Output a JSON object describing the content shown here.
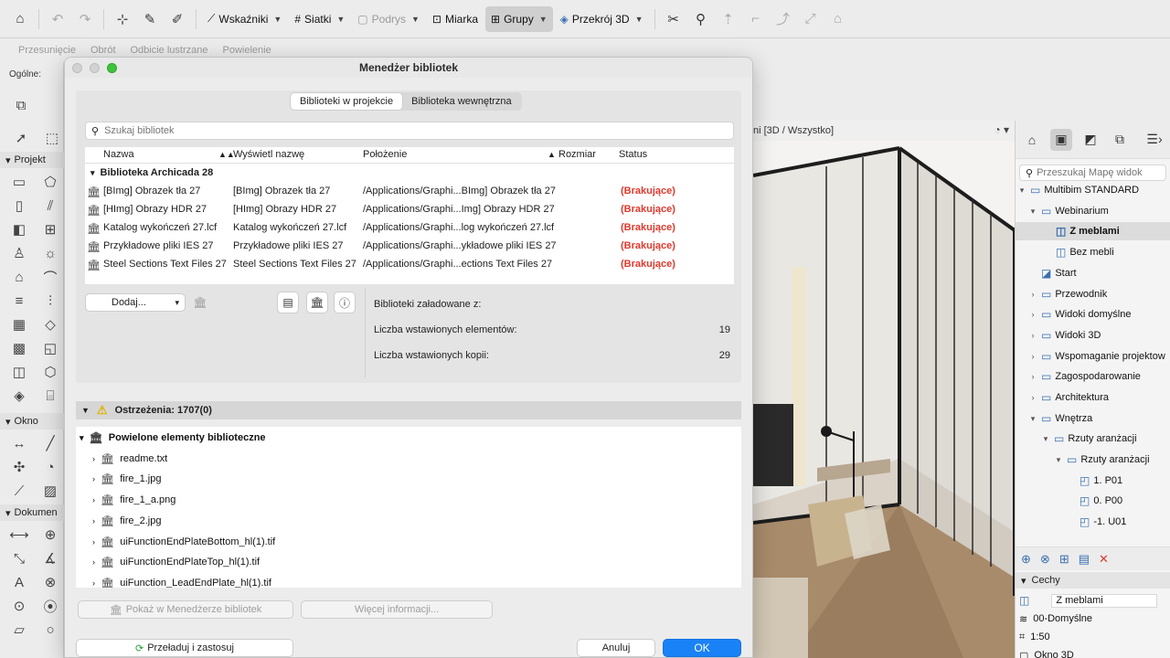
{
  "toolbar": {
    "wskazniki": "Wskaźniki",
    "siatki": "Siatki",
    "podrys": "Podrys",
    "miarka": "Miarka",
    "grupy": "Grupy",
    "przekroj": "Przekrój 3D"
  },
  "toolbar2": {
    "przesuniecie": "Przesunięcie",
    "obrot": "Obrót",
    "odbicie": "Odbicie lustrzane",
    "powielenie": "Powielenie"
  },
  "left": {
    "ogolne": "Ogólne:",
    "projekt": "Projekt",
    "okno": "Okno",
    "dokument": "Dokumen"
  },
  "view": {
    "header": "ni [3D / Wszystko]"
  },
  "dialog": {
    "title": "Menedżer bibliotek",
    "tabs": [
      "Biblioteki w projekcie",
      "Biblioteka wewnętrzna"
    ],
    "search_placeholder": "Szukaj bibliotek",
    "columns": {
      "name": "Nazwa",
      "display": "Wyświetl nazwę",
      "location": "Położenie",
      "size": "Rozmiar",
      "status": "Status"
    },
    "group": "Biblioteka Archicada 28",
    "rows": [
      {
        "name": "[BImg] Obrazek tła 27",
        "display": "[BImg] Obrazek tła 27",
        "location": "/Applications/Graphi...BImg] Obrazek tła 27",
        "status": "(Brakujące)"
      },
      {
        "name": "[HImg] Obrazy HDR 27",
        "display": "[HImg] Obrazy HDR 27",
        "location": "/Applications/Graphi...Img] Obrazy HDR 27",
        "status": "(Brakujące)"
      },
      {
        "name": "Katalog wykończeń 27.lcf",
        "display": "Katalog wykończeń 27.lcf",
        "location": "/Applications/Graphi...log wykończeń 27.lcf",
        "status": "(Brakujące)"
      },
      {
        "name": "Przykładowe pliki IES 27",
        "display": "Przykładowe pliki IES 27",
        "location": "/Applications/Graphi...ykładowe pliki IES 27",
        "status": "(Brakujące)"
      },
      {
        "name": "Steel Sections Text Files 27",
        "display": "Steel Sections Text Files 27",
        "location": "/Applications/Graphi...ections Text Files 27",
        "status": "(Brakujące)"
      }
    ],
    "add_label": "Dodaj...",
    "stats": {
      "loaded_from": "Biblioteki załadowane z:",
      "elements_label": "Liczba wstawionych elementów:",
      "elements_value": "19",
      "copies_label": "Liczba wstawionych kopii:",
      "copies_value": "29"
    },
    "warnings": {
      "header": "Ostrzeżenia: 1707(0)",
      "group": "Powielone elementy biblioteczne",
      "items": [
        "readme.txt",
        "fire_1.jpg",
        "fire_1_a.png",
        "fire_2.jpg",
        "uiFunctionEndPlateBottom_hl(1).tif",
        "uiFunctionEndPlateTop_hl(1).tif",
        "uiFunction_LeadEndPlate_hl(1).tif"
      ]
    },
    "show_in_manager": "Pokaż w Menedżerze bibliotek",
    "more_info": "Więcej informacji...",
    "reload": "Przeładuj i zastosuj",
    "cancel": "Anuluj",
    "ok": "OK"
  },
  "navigator": {
    "search_placeholder": "Przeszukaj Mapę widok",
    "tree": [
      {
        "label": "Multibim STANDARD"
      },
      {
        "label": "Webinarium"
      },
      {
        "label": "Z meblami"
      },
      {
        "label": "Bez mebli"
      },
      {
        "label": "Start"
      },
      {
        "label": "Przewodnik"
      },
      {
        "label": "Widoki domyślne"
      },
      {
        "label": "Widoki 3D"
      },
      {
        "label": "Wspomaganie projektow"
      },
      {
        "label": "Zagospodarowanie"
      },
      {
        "label": "Architektura"
      },
      {
        "label": "Wnętrza"
      },
      {
        "label": "Rzuty aranżacji"
      },
      {
        "label": "Rzuty aranżacji"
      },
      {
        "label": "1. P01"
      },
      {
        "label": "0. P00"
      },
      {
        "label": "-1. U01"
      }
    ],
    "props_header": "Cechy",
    "prop_name": "Z meblami",
    "prop_layer": "00-Domyślne",
    "prop_scale": "1:50",
    "prop_window": "Okno 3D"
  }
}
